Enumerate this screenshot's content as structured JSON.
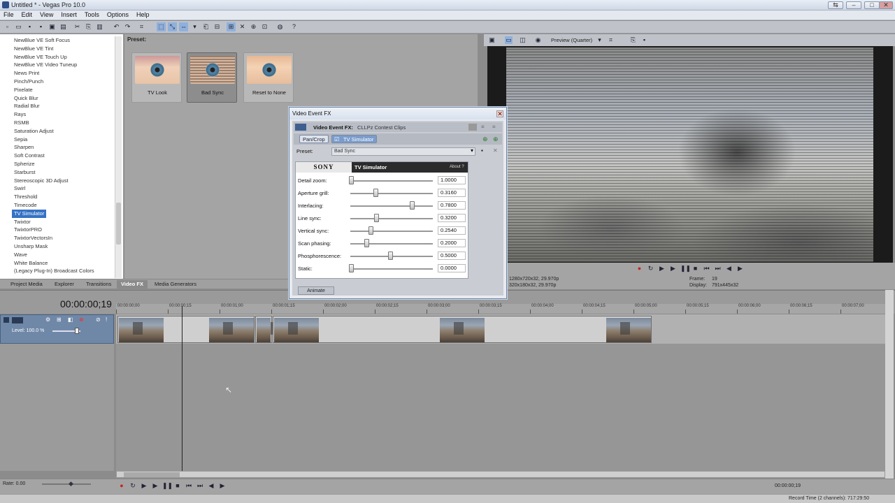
{
  "window": {
    "title": "Untitled * - Vegas Pro 10.0"
  },
  "menu": [
    "File",
    "Edit",
    "View",
    "Insert",
    "Tools",
    "Options",
    "Help"
  ],
  "fx_list": {
    "items": [
      "NewBlue VE Soft Focus",
      "NewBlue VE Tint",
      "NewBlue VE Touch Up",
      "NewBlue VE Video Tuneup",
      "News Print",
      "Pinch/Punch",
      "Pixelate",
      "Quick Blur",
      "Radial Blur",
      "Rays",
      "RSMB",
      "Saturation Adjust",
      "Sepia",
      "Sharpen",
      "Soft Contrast",
      "Spherize",
      "Starburst",
      "Stereoscopic 3D Adjust",
      "Swirl",
      "Threshold",
      "Timecode",
      "TV Simulator",
      "Twixtor",
      "TwixtorPRO",
      "TwixtorVectorsIn",
      "Unsharp Mask",
      "Wave",
      "White Balance",
      "(Legacy Plug-In) Broadcast Colors"
    ],
    "selected": "TV Simulator"
  },
  "preset_pane": {
    "label": "Preset:",
    "presets": [
      "TV Look",
      "Bad Sync",
      "Reset to None"
    ]
  },
  "tabs": [
    "Project Media",
    "Explorer",
    "Transitions",
    "Video FX",
    "Media Generators"
  ],
  "active_tab": "Video FX",
  "preview": {
    "mode": "Preview (Quarter)",
    "project_info": "1280x720x32, 29.970p",
    "preview_info": "320x180x32, 29.970p",
    "frame_label": "Frame:",
    "frame_value": "19",
    "display_label": "Display:",
    "display_value": "791x445x32"
  },
  "dialog": {
    "title": "Video Event FX",
    "header_label": "Video Event FX:",
    "header_value": "CLLPz Contest Clips",
    "chain": [
      "Pan/Crop",
      "TV Simulator"
    ],
    "preset_label": "Preset:",
    "preset_value": "Bad Sync",
    "brand": "SONY",
    "plugin_name": "TV Simulator",
    "about": "About ?",
    "params": [
      {
        "label": "Detail zoom:",
        "value": "1.0000",
        "pos": 0.0
      },
      {
        "label": "Aperture grill:",
        "value": "0.3160",
        "pos": 0.316
      },
      {
        "label": "Interlacing:",
        "value": "0.7800",
        "pos": 0.78
      },
      {
        "label": "Line sync:",
        "value": "0.3200",
        "pos": 0.32
      },
      {
        "label": "Vertical sync:",
        "value": "0.2540",
        "pos": 0.254
      },
      {
        "label": "Scan phasing:",
        "value": "0.2000",
        "pos": 0.2
      },
      {
        "label": "Phosphorescence:",
        "value": "0.5000",
        "pos": 0.5
      },
      {
        "label": "Static:",
        "value": "0.0000",
        "pos": 0.0
      }
    ],
    "animate": "Animate"
  },
  "timeline": {
    "timecode": "00:00:00;19",
    "level": "Level: 100.0 %",
    "ruler": [
      "00:00:00;00",
      "00:00:00;15",
      "00:00:01;00",
      "00:00:01;15",
      "00:00:02;00",
      "00:00:02;15",
      "00:00:03;00",
      "00:00:03;15",
      "00:00:04;00",
      "00:00:04;15",
      "00:00:05;00",
      "00:00:05;15",
      "00:00:06;00",
      "00:00:06;15",
      "00:00:07;00"
    ]
  },
  "bottom": {
    "rate": "Rate: 0.00",
    "time_right": "00:00:00;19",
    "record_time": "Record Time (2 channels): 717:29:50"
  }
}
